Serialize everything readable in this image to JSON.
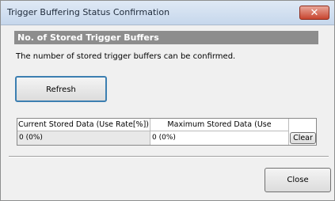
{
  "window": {
    "title": "Trigger Buffering Status Confirmation",
    "close_glyph": "✕"
  },
  "section": {
    "header": "No. of Stored Trigger Buffers"
  },
  "description": "The number of stored trigger buffers can be confirmed.",
  "buttons": {
    "refresh": "Refresh",
    "clear": "Clear",
    "close": "Close"
  },
  "table": {
    "headers": [
      "Current Stored Data (Use Rate[%])",
      "Maximum Stored Data (Use Rate[%])"
    ],
    "row": [
      "0 (0%)",
      "0 (0%)"
    ]
  }
}
